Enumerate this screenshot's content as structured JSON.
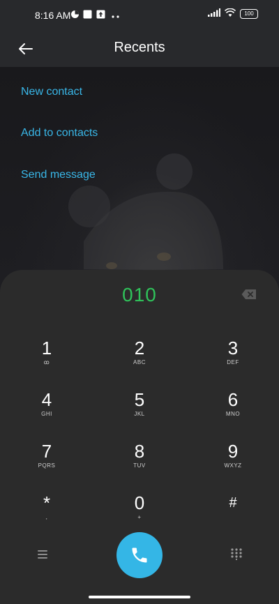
{
  "status_bar": {
    "time": "8:16 AM",
    "battery": "100"
  },
  "header": {
    "title": "Recents"
  },
  "actions": [
    {
      "label": "New contact"
    },
    {
      "label": "Add to contacts"
    },
    {
      "label": "Send message"
    }
  ],
  "dialer": {
    "number": "010",
    "keys": [
      {
        "digit": "1",
        "letters": "ꝏ"
      },
      {
        "digit": "2",
        "letters": "ABC"
      },
      {
        "digit": "3",
        "letters": "DEF"
      },
      {
        "digit": "4",
        "letters": "GHI"
      },
      {
        "digit": "5",
        "letters": "JKL"
      },
      {
        "digit": "6",
        "letters": "MNO"
      },
      {
        "digit": "7",
        "letters": "PQRS"
      },
      {
        "digit": "8",
        "letters": "TUV"
      },
      {
        "digit": "9",
        "letters": "WXYZ"
      },
      {
        "digit": "*",
        "letters": ","
      },
      {
        "digit": "0",
        "letters": "+"
      },
      {
        "digit": "#",
        "letters": ""
      }
    ]
  },
  "colors": {
    "accent_blue": "#39b7e8",
    "number_green": "#2fc25a",
    "call_button": "#34b6e6"
  },
  "icons": {
    "back": "back-arrow-icon",
    "backspace": "backspace-icon",
    "menu": "menu-icon",
    "call": "phone-icon",
    "dialpad": "dialpad-grid-icon"
  }
}
